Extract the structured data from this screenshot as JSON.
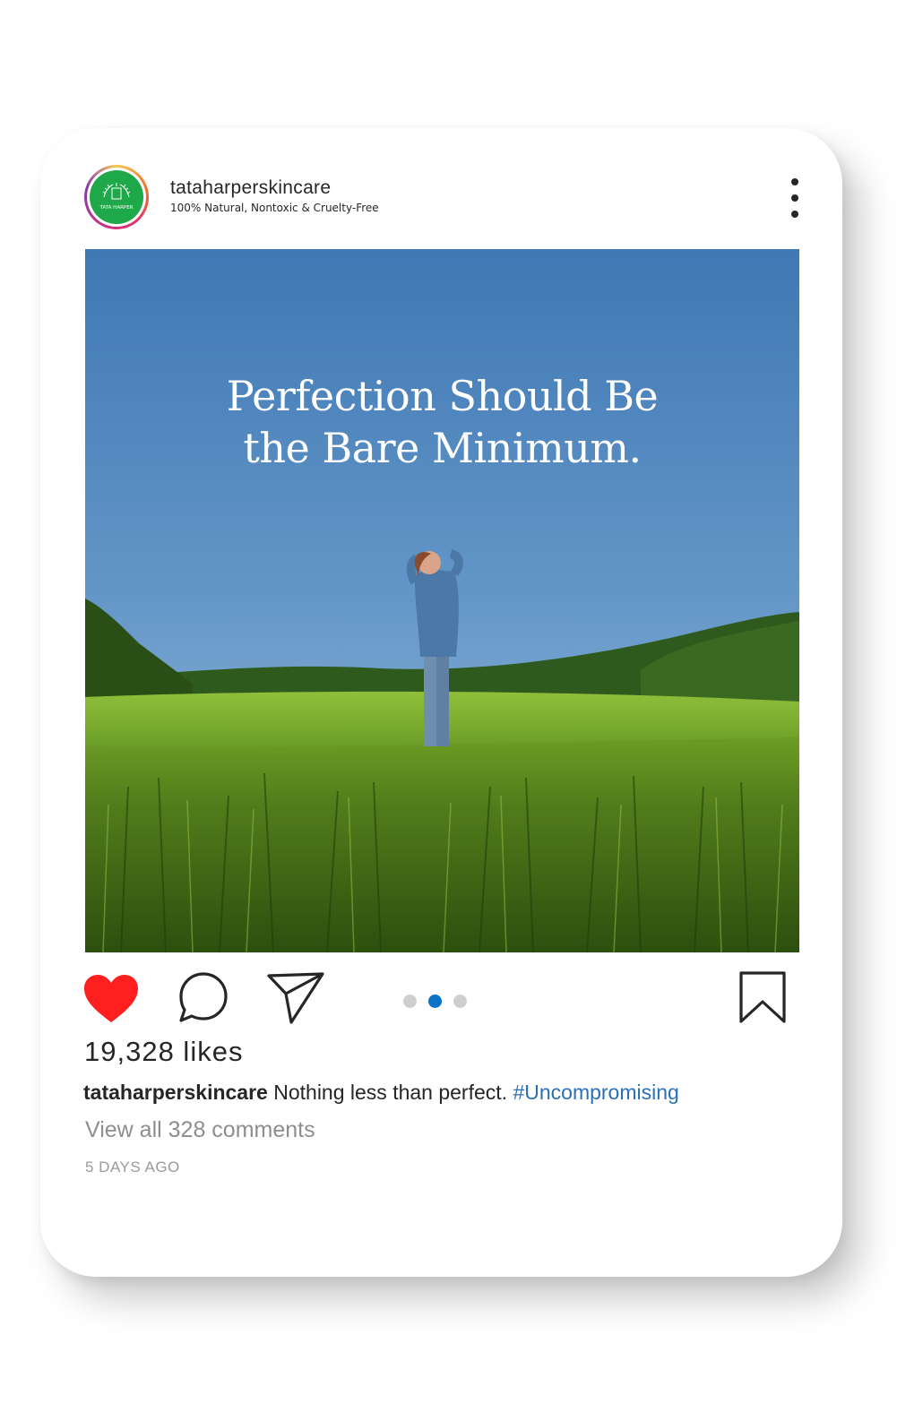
{
  "post": {
    "username": "tataharperskincare",
    "tagline": "100% Natural, Nontoxic & Cruelty-Free",
    "avatar_text": "TATA HARPER",
    "headline_line1": "Perfection Should Be",
    "headline_line2": "the Bare Minimum.",
    "likes": "19,328 likes",
    "caption_user": "tataharperskincare",
    "caption_text": " Nothing less than perfect. ",
    "caption_hashtag": "#Uncompromising",
    "view_comments": "View all 328 comments",
    "time_ago": "5 DAYS AGO",
    "carousel": {
      "count": 3,
      "active_index": 1
    },
    "liked": true
  },
  "colors": {
    "heart": "#ff1f1f",
    "hashtag": "#2a6fba",
    "active_dot": "#0a73c8",
    "avatar_bg": "#1ea84a"
  },
  "icons": [
    "more-options-icon",
    "heart-icon",
    "comment-icon",
    "share-icon",
    "bookmark-icon"
  ]
}
